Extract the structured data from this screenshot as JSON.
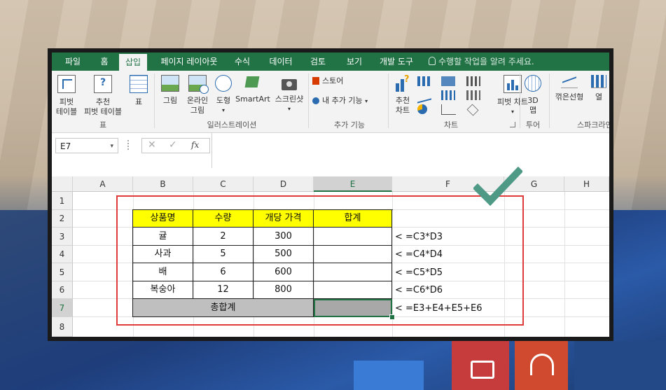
{
  "ribbon_tabs": [
    "파일",
    "홈",
    "삽입",
    "페이지 레이아웃",
    "수식",
    "데이터",
    "검토",
    "보기",
    "개발 도구"
  ],
  "active_tab": "삽입",
  "tell_me": "수행할 작업을 알려 주세요.",
  "ribbon": {
    "pivot_table": [
      "피벗",
      "테이블"
    ],
    "recommended_pivot": [
      "추천",
      "피벗 테이블"
    ],
    "table": "표",
    "group_tables": "표",
    "picture": "그림",
    "online_picture": [
      "온라인",
      "그림"
    ],
    "shapes": "도형",
    "smartart": "SmartArt",
    "screenshot": "스크린샷",
    "group_illustrations": "일러스트레이션",
    "store": "스토어",
    "my_addins": "내 추가 기능",
    "group_addins": "추가 기능",
    "recommended_charts": [
      "추천",
      "차트"
    ],
    "pivot_chart": "피벗 차트",
    "group_charts": "차트",
    "map_3d": [
      "3D",
      "맵"
    ],
    "group_tours": "투어",
    "line_sparkline": "꺾은선형",
    "column_sparkline": "열",
    "group_sparklines": "스파크라인"
  },
  "formula_bar": {
    "name_box": "E7",
    "fx": "fx",
    "formula": ""
  },
  "columns": [
    "A",
    "B",
    "C",
    "D",
    "E",
    "F",
    "G",
    "H"
  ],
  "rows": [
    "1",
    "2",
    "3",
    "4",
    "5",
    "6",
    "7",
    "8"
  ],
  "table": {
    "headers": [
      "상품명",
      "수량",
      "개당 가격",
      "합계"
    ],
    "rows": [
      [
        "귤",
        "2",
        "300",
        ""
      ],
      [
        "사과",
        "5",
        "500",
        ""
      ],
      [
        "배",
        "6",
        "600",
        ""
      ],
      [
        "복숭아",
        "12",
        "800",
        ""
      ]
    ],
    "total_label": "총합계",
    "total_value": ""
  },
  "notes": [
    "< =C3*D3",
    "< =C4*D4",
    "< =C5*D5",
    "< =C6*D6",
    "< =E3+E4+E5+E6"
  ],
  "colors": {
    "excel_green": "#217346",
    "header_yellow": "#ffff00",
    "total_gray": "#bfbfbf",
    "highlight_red": "#e03b3b",
    "check_teal": "#4e9a86"
  }
}
